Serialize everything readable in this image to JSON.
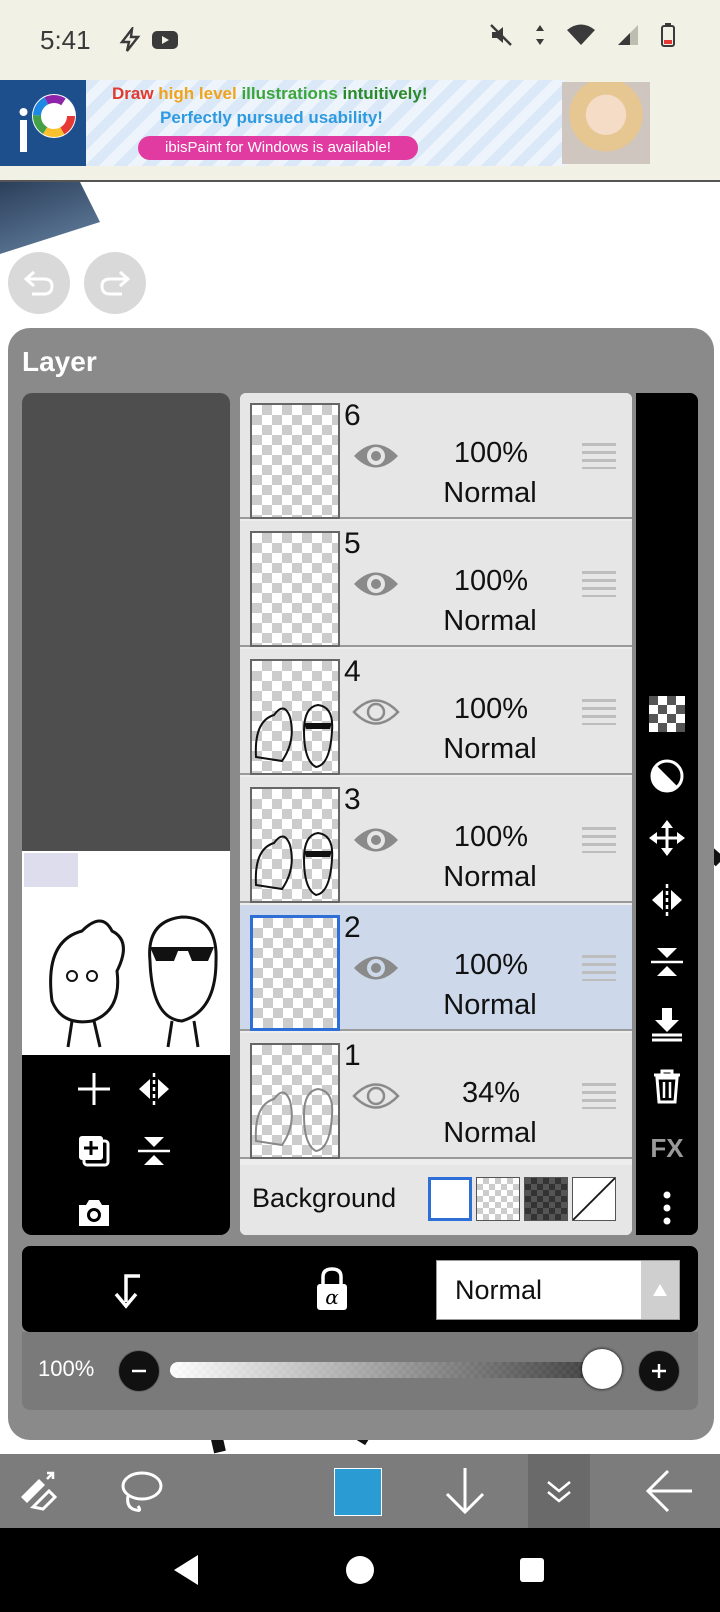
{
  "status_bar": {
    "time": "5:41"
  },
  "ad": {
    "line1_parts": [
      "Draw ",
      "high level ",
      "illustrations ",
      "intuitively!"
    ],
    "line1_colors": [
      "#e03a2e",
      "#f0a31c",
      "#3aa63a",
      "#2a8a2a"
    ],
    "line2": "Perfectly pursued usability!",
    "pill": "ibisPaint for Windows is available!"
  },
  "panel": {
    "title": "Layer"
  },
  "layers": [
    {
      "number": "6",
      "opacity": "100%",
      "mode": "Normal",
      "selected": false
    },
    {
      "number": "5",
      "opacity": "100%",
      "mode": "Normal",
      "selected": false
    },
    {
      "number": "4",
      "opacity": "100%",
      "mode": "Normal",
      "selected": false
    },
    {
      "number": "3",
      "opacity": "100%",
      "mode": "Normal",
      "selected": false
    },
    {
      "number": "2",
      "opacity": "100%",
      "mode": "Normal",
      "selected": true
    },
    {
      "number": "1",
      "opacity": "34%",
      "mode": "Normal",
      "selected": false
    }
  ],
  "background": {
    "label": "Background"
  },
  "blend_mode": {
    "value": "Normal"
  },
  "opacity_slider": {
    "label": "100%",
    "value": 1.0
  },
  "right_tools": {
    "fx_label": "FX"
  },
  "toolbar": {
    "color": "#2a9cd3"
  }
}
